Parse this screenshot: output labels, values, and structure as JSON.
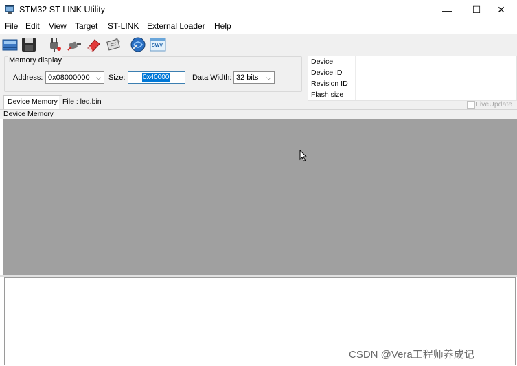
{
  "window": {
    "title": "STM32 ST-LINK Utility",
    "controls": {
      "minimize": "—",
      "maximize": "☐",
      "close": "✕"
    }
  },
  "menu": [
    "File",
    "Edit",
    "View",
    "Target",
    "ST-LINK",
    "External Loader",
    "Help"
  ],
  "toolbar": {
    "icons": [
      "open-file-icon",
      "save-icon",
      "connect-icon",
      "disconnect-icon",
      "erase-icon",
      "program-icon",
      "firmware-update-icon",
      "swv-icon"
    ],
    "swv_label": "SWV"
  },
  "memory_display": {
    "legend": "Memory display",
    "address_label": "Address:",
    "address_value": "0x08000000",
    "size_label": "Size:",
    "size_value": "0x40000",
    "data_width_label": "Data Width:",
    "data_width_value": "32 bits"
  },
  "device_info": {
    "rows": [
      "Device",
      "Device ID",
      "Revision ID",
      "Flash size"
    ]
  },
  "tabs": [
    "Device Memory",
    "File : led.bin"
  ],
  "live_update_label": "LiveUpdate",
  "memory_view_label": "Device Memory",
  "watermark": "CSDN @Vera工程师养成记",
  "colors": {
    "memory_bg": "#a0a0a0",
    "selection": "#0078d7"
  }
}
